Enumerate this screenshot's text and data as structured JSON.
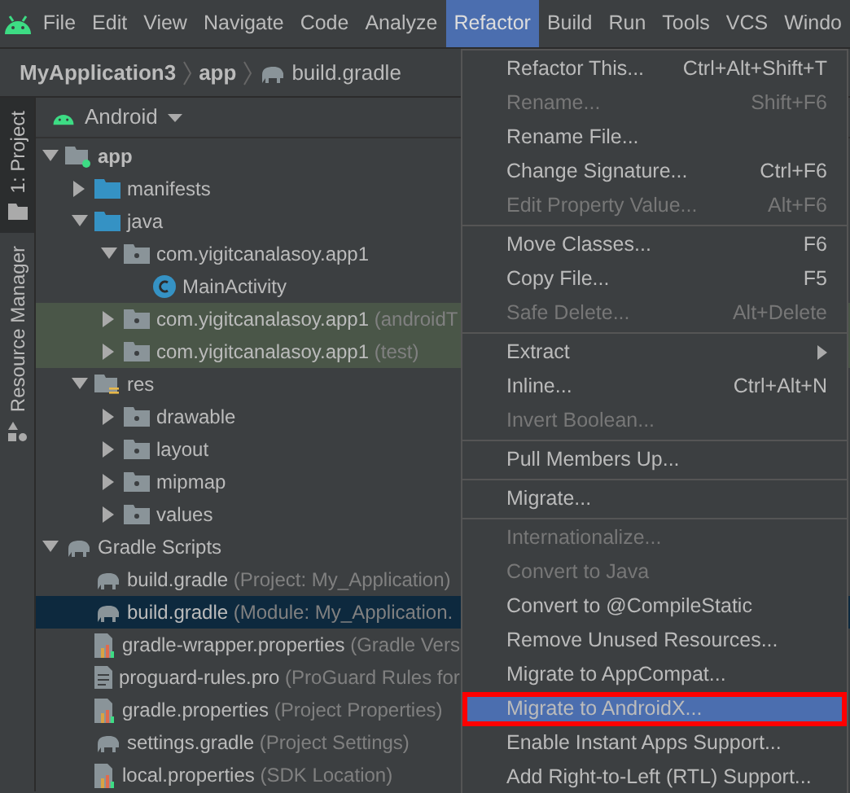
{
  "menubar": [
    {
      "label": "File",
      "selected": false
    },
    {
      "label": "Edit",
      "selected": false
    },
    {
      "label": "View",
      "selected": false
    },
    {
      "label": "Navigate",
      "selected": false
    },
    {
      "label": "Code",
      "selected": false
    },
    {
      "label": "Analyze",
      "selected": false
    },
    {
      "label": "Refactor",
      "selected": true
    },
    {
      "label": "Build",
      "selected": false
    },
    {
      "label": "Run",
      "selected": false
    },
    {
      "label": "Tools",
      "selected": false
    },
    {
      "label": "VCS",
      "selected": false
    },
    {
      "label": "Windo",
      "selected": false
    }
  ],
  "breadcrumb": [
    "MyApplication3",
    "app",
    "build.gradle"
  ],
  "side_tabs": [
    {
      "label": "1: Project",
      "selected": true
    },
    {
      "label": "Resource Manager",
      "selected": false
    }
  ],
  "panel": {
    "view": "Android"
  },
  "tree": [
    {
      "kind": "module",
      "label": "app",
      "expanded": true,
      "selected": false,
      "tinted": false,
      "children": [
        {
          "kind": "folder",
          "label": "manifests",
          "expanded": false,
          "selected": false,
          "tinted": false
        },
        {
          "kind": "folder",
          "label": "java",
          "expanded": true,
          "selected": false,
          "tinted": false,
          "children": [
            {
              "kind": "package",
              "label": "com.yigitcanalasoy.app1",
              "expanded": true,
              "selected": false,
              "tinted": false,
              "children": [
                {
                  "kind": "class",
                  "label": "MainActivity",
                  "selected": false,
                  "tinted": false
                }
              ]
            },
            {
              "kind": "package",
              "label": "com.yigitcanalasoy.app1",
              "note": "(androidT",
              "expanded": false,
              "selected": false,
              "tinted": true
            },
            {
              "kind": "package",
              "label": "com.yigitcanalasoy.app1",
              "note": "(test)",
              "expanded": false,
              "selected": false,
              "tinted": true
            }
          ]
        },
        {
          "kind": "res",
          "label": "res",
          "expanded": true,
          "selected": false,
          "tinted": false,
          "children": [
            {
              "kind": "package",
              "label": "drawable",
              "expanded": false,
              "selected": false,
              "tinted": false
            },
            {
              "kind": "package",
              "label": "layout",
              "expanded": false,
              "selected": false,
              "tinted": false
            },
            {
              "kind": "package",
              "label": "mipmap",
              "expanded": false,
              "selected": false,
              "tinted": false
            },
            {
              "kind": "package",
              "label": "values",
              "expanded": false,
              "selected": false,
              "tinted": false
            }
          ]
        }
      ]
    },
    {
      "kind": "gradle",
      "label": "Gradle Scripts",
      "expanded": true,
      "selected": false,
      "tinted": false,
      "children": [
        {
          "kind": "gradle",
          "label": "build.gradle",
          "note": "(Project: My_Application)",
          "selected": false,
          "tinted": false
        },
        {
          "kind": "gradle",
          "label": "build.gradle",
          "note": "(Module: My_Application.",
          "selected": true,
          "tinted": false
        },
        {
          "kind": "properties",
          "label": "gradle-wrapper.properties",
          "note": "(Gradle Vers",
          "selected": false,
          "tinted": false
        },
        {
          "kind": "file",
          "label": "proguard-rules.pro",
          "note": "(ProGuard Rules for",
          "selected": false,
          "tinted": false
        },
        {
          "kind": "properties",
          "label": "gradle.properties",
          "note": "(Project Properties)",
          "selected": false,
          "tinted": false
        },
        {
          "kind": "gradle",
          "label": "settings.gradle",
          "note": "(Project Settings)",
          "selected": false,
          "tinted": false
        },
        {
          "kind": "properties",
          "label": "local.properties",
          "note": "(SDK Location)",
          "selected": false,
          "tinted": false
        }
      ]
    }
  ],
  "menu": [
    [
      {
        "label": "Refactor This...",
        "shortcut": "Ctrl+Alt+Shift+T",
        "disabled": false,
        "selected": false,
        "highlighted": false
      },
      {
        "label": "Rename...",
        "shortcut": "Shift+F6",
        "disabled": true,
        "selected": false,
        "highlighted": false
      },
      {
        "label": "Rename File...",
        "disabled": false,
        "selected": false,
        "highlighted": false
      },
      {
        "label": "Change Signature...",
        "shortcut": "Ctrl+F6",
        "disabled": false,
        "selected": false,
        "highlighted": false
      },
      {
        "label": "Edit Property Value...",
        "shortcut": "Alt+F6",
        "disabled": true,
        "selected": false,
        "highlighted": false
      }
    ],
    [
      {
        "label": "Move Classes...",
        "shortcut": "F6",
        "disabled": false,
        "selected": false,
        "highlighted": false
      },
      {
        "label": "Copy File...",
        "shortcut": "F5",
        "disabled": false,
        "selected": false,
        "highlighted": false
      },
      {
        "label": "Safe Delete...",
        "shortcut": "Alt+Delete",
        "disabled": true,
        "selected": false,
        "highlighted": false
      }
    ],
    [
      {
        "label": "Extract",
        "submenu": true,
        "disabled": false,
        "selected": false,
        "highlighted": false
      },
      {
        "label": "Inline...",
        "shortcut": "Ctrl+Alt+N",
        "disabled": false,
        "selected": false,
        "highlighted": false
      },
      {
        "label": "Invert Boolean...",
        "disabled": true,
        "selected": false,
        "highlighted": false
      }
    ],
    [
      {
        "label": "Pull Members Up...",
        "disabled": false,
        "selected": false,
        "highlighted": false
      }
    ],
    [
      {
        "label": "Migrate...",
        "disabled": false,
        "selected": false,
        "highlighted": false
      }
    ],
    [
      {
        "label": "Internationalize...",
        "disabled": true,
        "selected": false,
        "highlighted": false
      },
      {
        "label": "Convert to Java",
        "disabled": true,
        "selected": false,
        "highlighted": false
      },
      {
        "label": "Convert to @CompileStatic",
        "disabled": false,
        "selected": false,
        "highlighted": false
      },
      {
        "label": "Remove Unused Resources...",
        "disabled": false,
        "selected": false,
        "highlighted": false
      },
      {
        "label": "Migrate to AppCompat...",
        "disabled": false,
        "selected": false,
        "highlighted": false
      },
      {
        "label": "Migrate to AndroidX...",
        "disabled": false,
        "selected": true,
        "highlighted": true
      },
      {
        "label": "Enable Instant Apps Support...",
        "disabled": false,
        "selected": false,
        "highlighted": false
      },
      {
        "label": "Add Right-to-Left (RTL) Support...",
        "disabled": false,
        "selected": false,
        "highlighted": false
      }
    ]
  ]
}
